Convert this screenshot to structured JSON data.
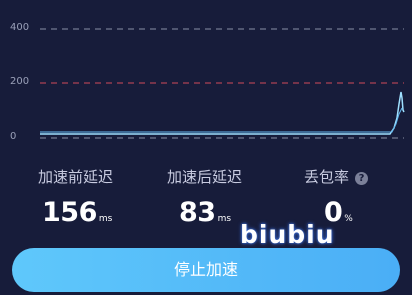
{
  "chart": {
    "ticks": [
      "400",
      "200",
      "0"
    ],
    "line_colors": {
      "ref400": "#8a8fa5",
      "ref200": "#d04a5a",
      "ref0": "#9aa0b8",
      "latency": "#9fe0ff"
    }
  },
  "stats": {
    "before": {
      "label": "加速前延迟",
      "value": "156",
      "unit": "ms"
    },
    "after": {
      "label": "加速后延迟",
      "value": "83",
      "unit": "ms"
    },
    "loss": {
      "label": "丢包率",
      "value": "0",
      "unit": "%",
      "help": "?"
    }
  },
  "watermark": "biubiu",
  "button": {
    "label": "停止加速"
  }
}
